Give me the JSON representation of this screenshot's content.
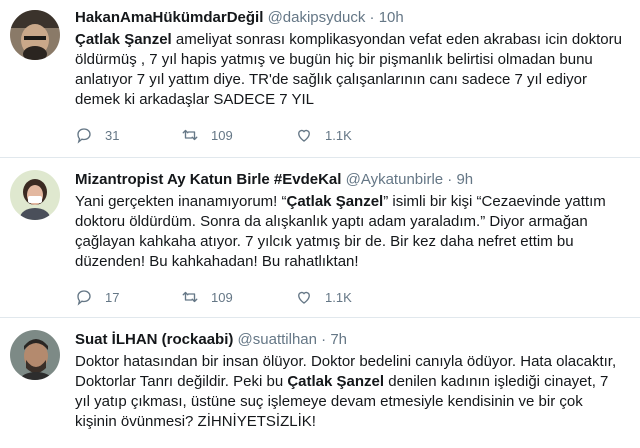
{
  "tweets": [
    {
      "name": "HakanAmaHükümdarDeğil",
      "handle": "@dakipsyduck",
      "sep": "·",
      "time": "10h",
      "bold": "Çatlak Şanzel",
      "text_after_bold": " ameliyat sonrası komplikasyondan vefat eden akrabası icin doktoru öldürmüş , 7 yıl hapis yatmış ve bugün hiç bir pişmanlık belirtisi olmadan bunu anlatıyor 7 yıl yattım diye. TR'de sağlık çalışanlarının canı sadece 7 yıl ediyor demek ki arkadaşlar SADECE 7 YIL",
      "replies": "31",
      "retweets": "109",
      "likes": "1.1K"
    },
    {
      "name": "Mizantropist Ay Katun Birle #EvdeKal",
      "handle": "@Aykatunbirle",
      "sep": "·",
      "time": "9h",
      "text_before_bold": "Yani gerçekten inanamıyorum! “",
      "bold": "Çatlak Şanzel",
      "text_after_bold": "” isimli bir kişi “Cezaevinde yattım doktoru öldürdüm. Sonra da alışkanlık yaptı adam yaraladım.” Diyor armağan çağlayan kahkaha atıyor. 7 yılcık yatmış bir de. Bir kez daha nefret ettim bu düzenden! Bu kahkahadan! Bu rahatlıktan!",
      "replies": "17",
      "retweets": "109",
      "likes": "1.1K"
    },
    {
      "name": "Suat İLHAN (rockaabi)",
      "handle": "@suattilhan",
      "sep": "·",
      "time": "7h",
      "text_before_bold": "Doktor hatasından bir insan ölüyor. Doktor bedelini canıyla ödüyor. Hata olacaktır, Doktorlar Tanrı değildir. Peki bu ",
      "bold": "Çatlak Şanzel",
      "text_after_bold": " denilen kadının işlediği cinayet, 7 yıl yatıp çıkması, üstüne suç işlemeye devam etmesiyle kendisinin ve bir çok kişinin övünmesi? ZİHNİYETSİZLİK!"
    }
  ],
  "colors": {
    "text": "#14171a",
    "muted": "#657786",
    "divider": "#e1e8ed"
  },
  "icons": [
    "avatar",
    "reply-icon",
    "retweet-icon",
    "like-icon"
  ]
}
